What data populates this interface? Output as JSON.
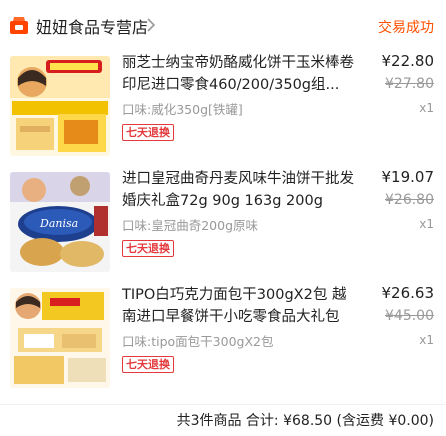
{
  "shop": {
    "name": "妞妞食品专营店",
    "status": "交易成功",
    "icon": "shop-icon",
    "accent": "#ff5000"
  },
  "items": [
    {
      "title": "丽芝士纳宝帝奶酪威化饼干玉米棒卷印尼进口零食460/200/350g组...",
      "flavor": "口味:威化350g[铁罐]",
      "tag": "七天退换",
      "price": "¥22.80",
      "original_price": "¥27.80",
      "quantity": "x1"
    },
    {
      "title": "进口皇冠曲奇丹麦风味牛油饼干批发婚庆礼盒72g 90g 163g 200g",
      "flavor": "口味:皇冠曲奇200g原味",
      "tag": "七天退换",
      "price": "¥19.07",
      "original_price": "¥26.80",
      "quantity": "x1"
    },
    {
      "title": "TIPO白巧克力面包干300gX2包 越南进口早餐饼干小吃零食品大礼包",
      "flavor": "口味:tipo面包干300gX2包",
      "tag": "七天退换",
      "price": "¥26.63",
      "original_price": "¥45.00",
      "quantity": "x1"
    }
  ],
  "footer": {
    "summary": "共3件商品  合计: ¥68.50 (含运费 ¥0.00)"
  }
}
